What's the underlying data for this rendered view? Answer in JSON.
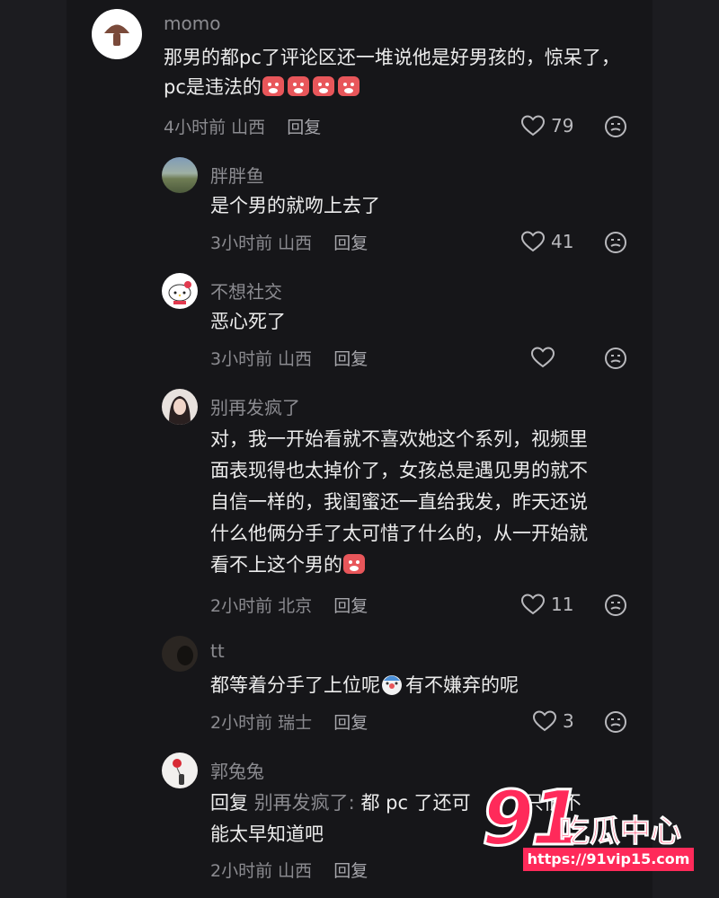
{
  "comments": [
    {
      "user": "momo",
      "text": "那男的都pc了评论区还一堆说他是好男孩的，惊呆了，pc是违法的",
      "time": "4小时前",
      "location": "山西",
      "reply_label": "回复",
      "likes": "79",
      "emoji_count": 4
    },
    {
      "user": "胖胖鱼",
      "text": "是个男的就吻上去了",
      "time": "3小时前",
      "location": "山西",
      "reply_label": "回复",
      "likes": "41"
    },
    {
      "user": "不想社交",
      "text": "恶心死了",
      "time": "3小时前",
      "location": "山西",
      "reply_label": "回复",
      "likes": ""
    },
    {
      "user": "别再发疯了",
      "text_lines": [
        "对，我一开始看就不喜欢她这个系列，视频里",
        "面表现得也太掉价了，女孩总是遇见男的就不",
        "自信一样的，我闺蜜还一直给我发，昨天还说",
        "什么他俩分手了太可惜了什么的，从一开始就",
        "看不上这个男的"
      ],
      "time": "2小时前",
      "location": "北京",
      "reply_label": "回复",
      "likes": "11"
    },
    {
      "user": "tt",
      "text_before": "都等着分手了上位呢",
      "text_after": "有不嫌弃的呢",
      "time": "2小时前",
      "location": "瑞士",
      "reply_label": "回复",
      "likes": "3"
    },
    {
      "user": "郭兔兔",
      "reply_prefix": "回复",
      "reply_to": "别再发疯了:",
      "text_line1": "都 pc 了还可",
      "text_line1_tail": "只恨不",
      "text_line2": "能太早知道吧",
      "time": "2小时前",
      "location": "山西",
      "reply_label": "回复"
    }
  ],
  "watermark": {
    "number": "91",
    "brand": "吃瓜中心",
    "url": "https://91vip15.com"
  },
  "colors": {
    "background": "#161619",
    "outer": "#1c1c20",
    "text": "#ececec",
    "muted": "#8b8b90",
    "emoji_red": "#e8565a",
    "watermark_pink": "#ff2a5a"
  }
}
